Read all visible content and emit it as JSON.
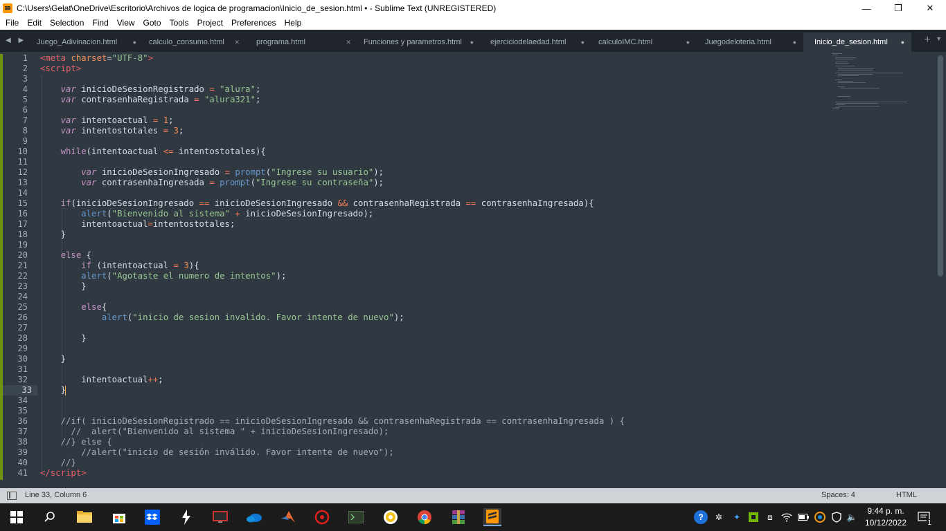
{
  "window": {
    "title": "C:\\Users\\Gelat\\OneDrive\\Escritorio\\Archivos de logica de programacion\\Inicio_de_sesion.html • - Sublime Text (UNREGISTERED)",
    "minimize": "—",
    "maximize": "❐",
    "close": "✕"
  },
  "menu": [
    "File",
    "Edit",
    "Selection",
    "Find",
    "View",
    "Goto",
    "Tools",
    "Project",
    "Preferences",
    "Help"
  ],
  "tabs": [
    {
      "label": "Juego_Adivinacion.html",
      "close": "●"
    },
    {
      "label": "calculo_consumo.html",
      "close": "✕"
    },
    {
      "label": "programa.html",
      "close": "✕"
    },
    {
      "label": "Funciones y parametros.html",
      "close": "●"
    },
    {
      "label": "ejerciciodelaedad.html",
      "close": "●"
    },
    {
      "label": "calculoIMC.html",
      "close": "●"
    },
    {
      "label": "Juegodeloteria.html",
      "close": "●"
    },
    {
      "label": "Inicio_de_sesion.html",
      "close": "●"
    }
  ],
  "tab_nav": "◀ ▶",
  "tab_plus": "+",
  "tab_more": "▼",
  "editor": {
    "current_line": 33,
    "line_count": 41
  },
  "status": {
    "position": "Line 33, Column 6",
    "spaces": "Spaces: 4",
    "syntax": "HTML"
  },
  "taskbar": {
    "time": "9:44 p. m.",
    "date": "10/12/2022",
    "notifications": "1",
    "accent": "#1c1c1c"
  },
  "colors": {
    "editor_bg": "#303841",
    "tab_bar_bg": "#1f252b",
    "string": "#99c794",
    "keyword": "#c594c5",
    "function": "#6699cc",
    "operator": "#f97b58",
    "tag": "#ec5f67"
  }
}
